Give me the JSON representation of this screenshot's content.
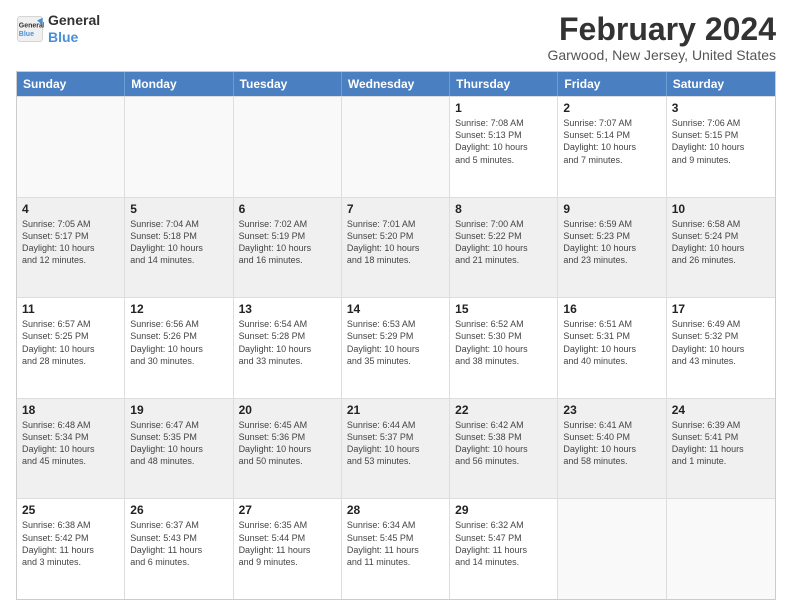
{
  "logo": {
    "line1": "General",
    "line2": "Blue"
  },
  "title": "February 2024",
  "location": "Garwood, New Jersey, United States",
  "days_of_week": [
    "Sunday",
    "Monday",
    "Tuesday",
    "Wednesday",
    "Thursday",
    "Friday",
    "Saturday"
  ],
  "weeks": [
    {
      "alt": false,
      "cells": [
        {
          "day": "",
          "info": ""
        },
        {
          "day": "",
          "info": ""
        },
        {
          "day": "",
          "info": ""
        },
        {
          "day": "",
          "info": ""
        },
        {
          "day": "1",
          "info": "Sunrise: 7:08 AM\nSunset: 5:13 PM\nDaylight: 10 hours\nand 5 minutes."
        },
        {
          "day": "2",
          "info": "Sunrise: 7:07 AM\nSunset: 5:14 PM\nDaylight: 10 hours\nand 7 minutes."
        },
        {
          "day": "3",
          "info": "Sunrise: 7:06 AM\nSunset: 5:15 PM\nDaylight: 10 hours\nand 9 minutes."
        }
      ]
    },
    {
      "alt": true,
      "cells": [
        {
          "day": "4",
          "info": "Sunrise: 7:05 AM\nSunset: 5:17 PM\nDaylight: 10 hours\nand 12 minutes."
        },
        {
          "day": "5",
          "info": "Sunrise: 7:04 AM\nSunset: 5:18 PM\nDaylight: 10 hours\nand 14 minutes."
        },
        {
          "day": "6",
          "info": "Sunrise: 7:02 AM\nSunset: 5:19 PM\nDaylight: 10 hours\nand 16 minutes."
        },
        {
          "day": "7",
          "info": "Sunrise: 7:01 AM\nSunset: 5:20 PM\nDaylight: 10 hours\nand 18 minutes."
        },
        {
          "day": "8",
          "info": "Sunrise: 7:00 AM\nSunset: 5:22 PM\nDaylight: 10 hours\nand 21 minutes."
        },
        {
          "day": "9",
          "info": "Sunrise: 6:59 AM\nSunset: 5:23 PM\nDaylight: 10 hours\nand 23 minutes."
        },
        {
          "day": "10",
          "info": "Sunrise: 6:58 AM\nSunset: 5:24 PM\nDaylight: 10 hours\nand 26 minutes."
        }
      ]
    },
    {
      "alt": false,
      "cells": [
        {
          "day": "11",
          "info": "Sunrise: 6:57 AM\nSunset: 5:25 PM\nDaylight: 10 hours\nand 28 minutes."
        },
        {
          "day": "12",
          "info": "Sunrise: 6:56 AM\nSunset: 5:26 PM\nDaylight: 10 hours\nand 30 minutes."
        },
        {
          "day": "13",
          "info": "Sunrise: 6:54 AM\nSunset: 5:28 PM\nDaylight: 10 hours\nand 33 minutes."
        },
        {
          "day": "14",
          "info": "Sunrise: 6:53 AM\nSunset: 5:29 PM\nDaylight: 10 hours\nand 35 minutes."
        },
        {
          "day": "15",
          "info": "Sunrise: 6:52 AM\nSunset: 5:30 PM\nDaylight: 10 hours\nand 38 minutes."
        },
        {
          "day": "16",
          "info": "Sunrise: 6:51 AM\nSunset: 5:31 PM\nDaylight: 10 hours\nand 40 minutes."
        },
        {
          "day": "17",
          "info": "Sunrise: 6:49 AM\nSunset: 5:32 PM\nDaylight: 10 hours\nand 43 minutes."
        }
      ]
    },
    {
      "alt": true,
      "cells": [
        {
          "day": "18",
          "info": "Sunrise: 6:48 AM\nSunset: 5:34 PM\nDaylight: 10 hours\nand 45 minutes."
        },
        {
          "day": "19",
          "info": "Sunrise: 6:47 AM\nSunset: 5:35 PM\nDaylight: 10 hours\nand 48 minutes."
        },
        {
          "day": "20",
          "info": "Sunrise: 6:45 AM\nSunset: 5:36 PM\nDaylight: 10 hours\nand 50 minutes."
        },
        {
          "day": "21",
          "info": "Sunrise: 6:44 AM\nSunset: 5:37 PM\nDaylight: 10 hours\nand 53 minutes."
        },
        {
          "day": "22",
          "info": "Sunrise: 6:42 AM\nSunset: 5:38 PM\nDaylight: 10 hours\nand 56 minutes."
        },
        {
          "day": "23",
          "info": "Sunrise: 6:41 AM\nSunset: 5:40 PM\nDaylight: 10 hours\nand 58 minutes."
        },
        {
          "day": "24",
          "info": "Sunrise: 6:39 AM\nSunset: 5:41 PM\nDaylight: 11 hours\nand 1 minute."
        }
      ]
    },
    {
      "alt": false,
      "cells": [
        {
          "day": "25",
          "info": "Sunrise: 6:38 AM\nSunset: 5:42 PM\nDaylight: 11 hours\nand 3 minutes."
        },
        {
          "day": "26",
          "info": "Sunrise: 6:37 AM\nSunset: 5:43 PM\nDaylight: 11 hours\nand 6 minutes."
        },
        {
          "day": "27",
          "info": "Sunrise: 6:35 AM\nSunset: 5:44 PM\nDaylight: 11 hours\nand 9 minutes."
        },
        {
          "day": "28",
          "info": "Sunrise: 6:34 AM\nSunset: 5:45 PM\nDaylight: 11 hours\nand 11 minutes."
        },
        {
          "day": "29",
          "info": "Sunrise: 6:32 AM\nSunset: 5:47 PM\nDaylight: 11 hours\nand 14 minutes."
        },
        {
          "day": "",
          "info": ""
        },
        {
          "day": "",
          "info": ""
        }
      ]
    }
  ]
}
